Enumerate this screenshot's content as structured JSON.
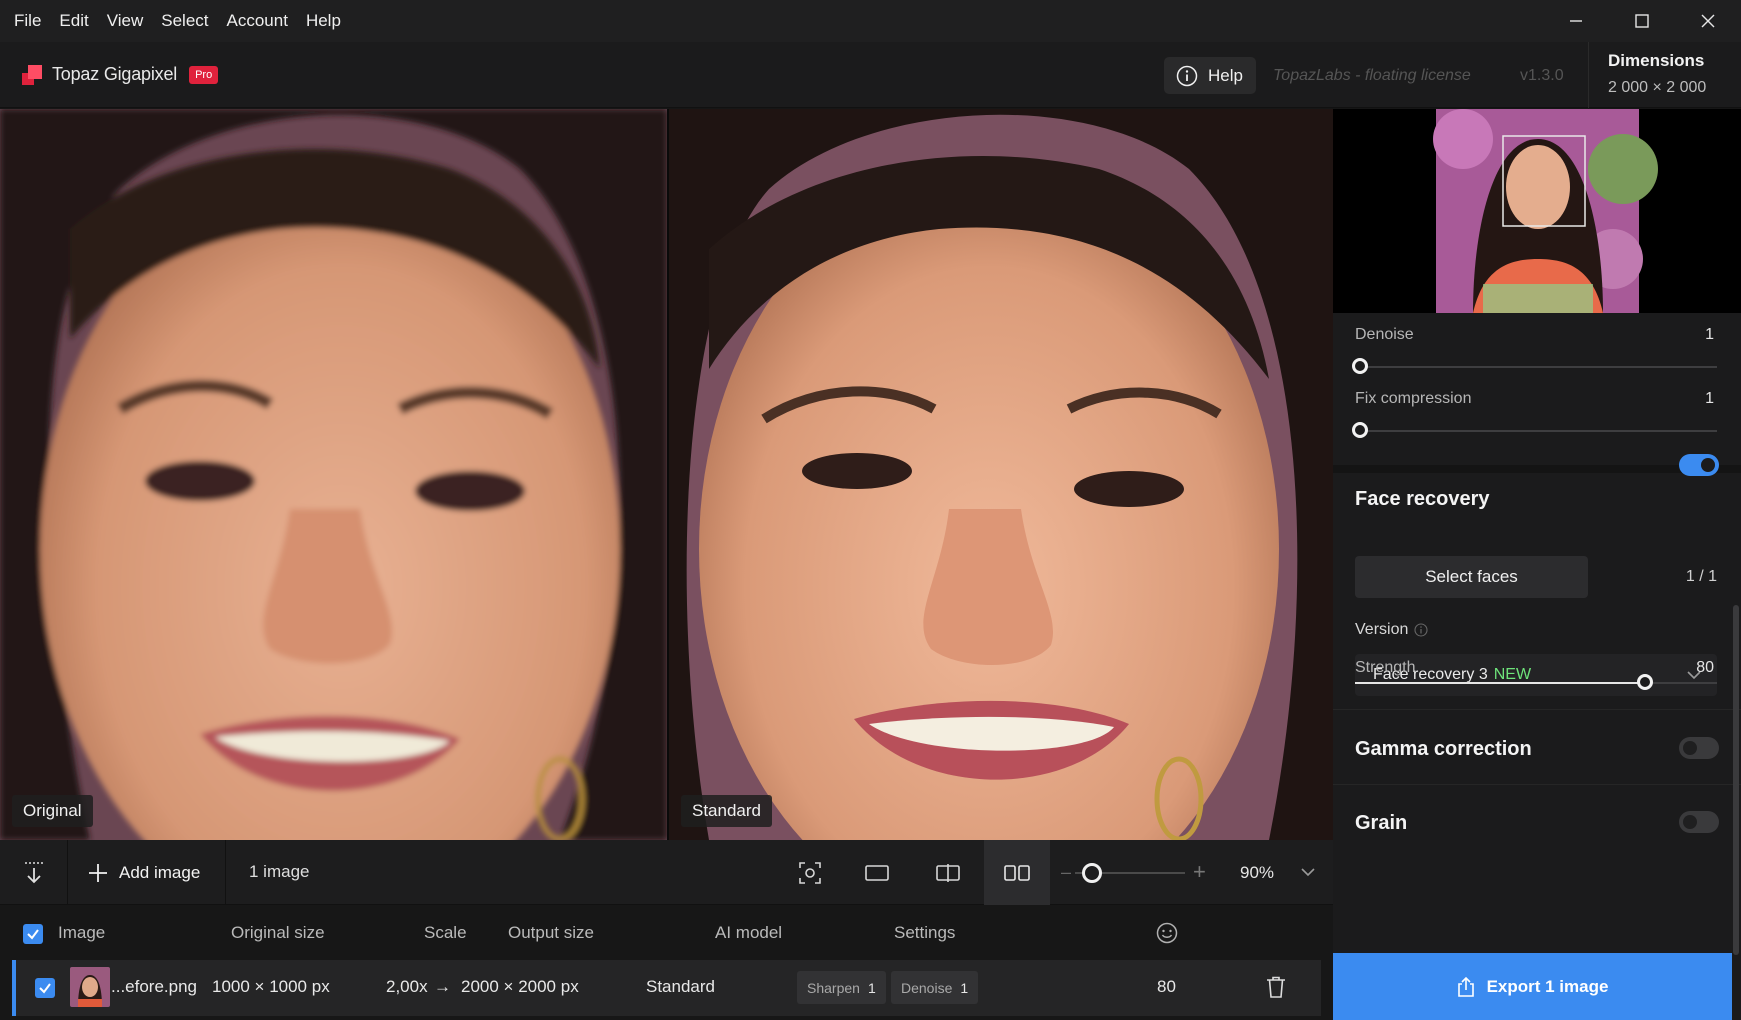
{
  "menu": [
    "File",
    "Edit",
    "View",
    "Select",
    "Account",
    "Help"
  ],
  "app": {
    "name": "Topaz Gigapixel",
    "badge": "Pro",
    "help_label": "Help",
    "license": "TopazLabs - floating license",
    "version": "v1.3.0",
    "dimensions_title": "Dimensions",
    "dimensions_value": "2 000 × 2 000"
  },
  "preview": {
    "left_label": "Original",
    "right_label": "Standard"
  },
  "toolbar": {
    "add_label": "Add image",
    "count": "1 image",
    "zoom": "90%"
  },
  "table": {
    "headers": {
      "image": "Image",
      "original_size": "Original size",
      "scale": "Scale",
      "output_size": "Output size",
      "ai_model": "AI model",
      "settings": "Settings"
    },
    "row": {
      "filename": "...efore.png",
      "original_size": "1000 × 1000 px",
      "scale": "2,00x",
      "arrow": "→",
      "output_size": "2000 × 2000 px",
      "model": "Standard",
      "sharpen_label": "Sharpen",
      "sharpen_value": "1",
      "denoise_label": "Denoise",
      "denoise_value": "1",
      "face_strength": "80"
    }
  },
  "panel": {
    "denoise": {
      "label": "Denoise",
      "value": "1",
      "level": 0
    },
    "fix_compression": {
      "label": "Fix compression",
      "value": "1",
      "level": 0
    },
    "face_recovery": {
      "title": "Face recovery",
      "enabled": true,
      "select_faces": "Select faces",
      "faces_count": "1 / 1",
      "version_label": "Version",
      "version_value": "Face recovery 3",
      "version_tag": "NEW",
      "strength_label": "Strength",
      "strength_value": "80",
      "strength_level": 0.8
    },
    "gamma": {
      "title": "Gamma correction",
      "enabled": false
    },
    "grain": {
      "title": "Grain",
      "enabled": false
    },
    "export_label": "Export 1 image"
  },
  "colors": {
    "accent": "#3b8bf0",
    "brand": "#e0223c",
    "new_tag": "#6ee37a"
  }
}
